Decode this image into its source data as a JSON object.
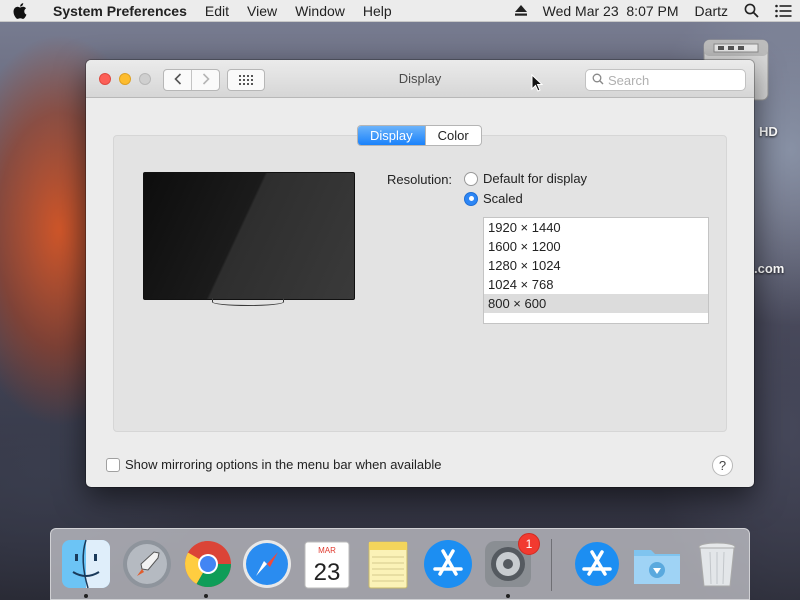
{
  "menubar": {
    "app_name": "System Preferences",
    "menus": [
      "Edit",
      "View",
      "Window",
      "Help"
    ],
    "datetime": "Wed Mar 23  8:07 PM",
    "user": "Dartz"
  },
  "desktop": {
    "hd_label": "HD",
    "com_label": ".com"
  },
  "window": {
    "title": "Display",
    "search_placeholder": "Search"
  },
  "tabs": [
    {
      "label": "Display",
      "active": true
    },
    {
      "label": "Color",
      "active": false
    }
  ],
  "resolution": {
    "label": "Resolution:",
    "options": [
      "Default for display",
      "Scaled"
    ],
    "selected_option": "Scaled",
    "list": [
      "1920 × 1440",
      "1600 × 1200",
      "1280 × 1024",
      "1024 × 768",
      "800 × 600"
    ],
    "selected_resolution": "800 × 600"
  },
  "mirroring": {
    "label": "Show mirroring options in the menu bar when available",
    "checked": false
  },
  "help_label": "?",
  "dock": {
    "items": [
      "finder-icon",
      "launchpad-icon",
      "chrome-icon",
      "safari-icon",
      "calendar-icon",
      "notes-icon",
      "app-store-icon",
      "system-preferences-icon",
      "applications-folder-icon",
      "downloads-folder-icon",
      "trash-icon"
    ],
    "calendar_month": "MAR",
    "calendar_day": "23",
    "sysprefs_badge": "1"
  },
  "colors": {
    "accent": "#1a82fb",
    "close": "#fc5f57",
    "minimize": "#fdbc2e",
    "badge": "#f23a30"
  }
}
